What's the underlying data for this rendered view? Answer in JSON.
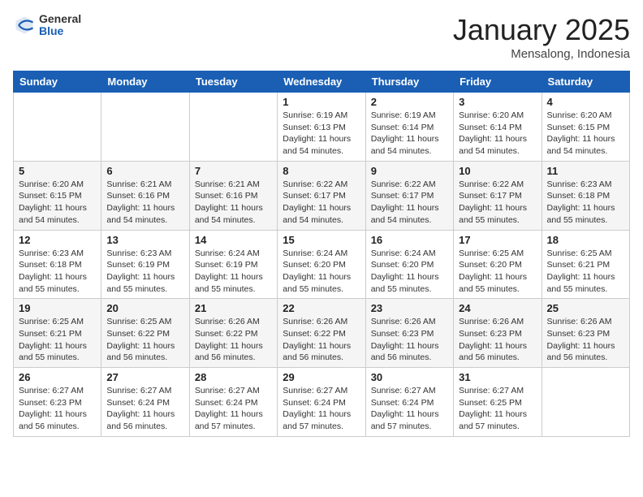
{
  "header": {
    "logo_general": "General",
    "logo_blue": "Blue",
    "month_title": "January 2025",
    "location": "Mensalong, Indonesia"
  },
  "weekdays": [
    "Sunday",
    "Monday",
    "Tuesday",
    "Wednesday",
    "Thursday",
    "Friday",
    "Saturday"
  ],
  "weeks": [
    [
      {
        "day": "",
        "sunrise": "",
        "sunset": "",
        "daylight": ""
      },
      {
        "day": "",
        "sunrise": "",
        "sunset": "",
        "daylight": ""
      },
      {
        "day": "",
        "sunrise": "",
        "sunset": "",
        "daylight": ""
      },
      {
        "day": "1",
        "sunrise": "Sunrise: 6:19 AM",
        "sunset": "Sunset: 6:13 PM",
        "daylight": "Daylight: 11 hours and 54 minutes."
      },
      {
        "day": "2",
        "sunrise": "Sunrise: 6:19 AM",
        "sunset": "Sunset: 6:14 PM",
        "daylight": "Daylight: 11 hours and 54 minutes."
      },
      {
        "day": "3",
        "sunrise": "Sunrise: 6:20 AM",
        "sunset": "Sunset: 6:14 PM",
        "daylight": "Daylight: 11 hours and 54 minutes."
      },
      {
        "day": "4",
        "sunrise": "Sunrise: 6:20 AM",
        "sunset": "Sunset: 6:15 PM",
        "daylight": "Daylight: 11 hours and 54 minutes."
      }
    ],
    [
      {
        "day": "5",
        "sunrise": "Sunrise: 6:20 AM",
        "sunset": "Sunset: 6:15 PM",
        "daylight": "Daylight: 11 hours and 54 minutes."
      },
      {
        "day": "6",
        "sunrise": "Sunrise: 6:21 AM",
        "sunset": "Sunset: 6:16 PM",
        "daylight": "Daylight: 11 hours and 54 minutes."
      },
      {
        "day": "7",
        "sunrise": "Sunrise: 6:21 AM",
        "sunset": "Sunset: 6:16 PM",
        "daylight": "Daylight: 11 hours and 54 minutes."
      },
      {
        "day": "8",
        "sunrise": "Sunrise: 6:22 AM",
        "sunset": "Sunset: 6:17 PM",
        "daylight": "Daylight: 11 hours and 54 minutes."
      },
      {
        "day": "9",
        "sunrise": "Sunrise: 6:22 AM",
        "sunset": "Sunset: 6:17 PM",
        "daylight": "Daylight: 11 hours and 54 minutes."
      },
      {
        "day": "10",
        "sunrise": "Sunrise: 6:22 AM",
        "sunset": "Sunset: 6:17 PM",
        "daylight": "Daylight: 11 hours and 55 minutes."
      },
      {
        "day": "11",
        "sunrise": "Sunrise: 6:23 AM",
        "sunset": "Sunset: 6:18 PM",
        "daylight": "Daylight: 11 hours and 55 minutes."
      }
    ],
    [
      {
        "day": "12",
        "sunrise": "Sunrise: 6:23 AM",
        "sunset": "Sunset: 6:18 PM",
        "daylight": "Daylight: 11 hours and 55 minutes."
      },
      {
        "day": "13",
        "sunrise": "Sunrise: 6:23 AM",
        "sunset": "Sunset: 6:19 PM",
        "daylight": "Daylight: 11 hours and 55 minutes."
      },
      {
        "day": "14",
        "sunrise": "Sunrise: 6:24 AM",
        "sunset": "Sunset: 6:19 PM",
        "daylight": "Daylight: 11 hours and 55 minutes."
      },
      {
        "day": "15",
        "sunrise": "Sunrise: 6:24 AM",
        "sunset": "Sunset: 6:20 PM",
        "daylight": "Daylight: 11 hours and 55 minutes."
      },
      {
        "day": "16",
        "sunrise": "Sunrise: 6:24 AM",
        "sunset": "Sunset: 6:20 PM",
        "daylight": "Daylight: 11 hours and 55 minutes."
      },
      {
        "day": "17",
        "sunrise": "Sunrise: 6:25 AM",
        "sunset": "Sunset: 6:20 PM",
        "daylight": "Daylight: 11 hours and 55 minutes."
      },
      {
        "day": "18",
        "sunrise": "Sunrise: 6:25 AM",
        "sunset": "Sunset: 6:21 PM",
        "daylight": "Daylight: 11 hours and 55 minutes."
      }
    ],
    [
      {
        "day": "19",
        "sunrise": "Sunrise: 6:25 AM",
        "sunset": "Sunset: 6:21 PM",
        "daylight": "Daylight: 11 hours and 55 minutes."
      },
      {
        "day": "20",
        "sunrise": "Sunrise: 6:25 AM",
        "sunset": "Sunset: 6:22 PM",
        "daylight": "Daylight: 11 hours and 56 minutes."
      },
      {
        "day": "21",
        "sunrise": "Sunrise: 6:26 AM",
        "sunset": "Sunset: 6:22 PM",
        "daylight": "Daylight: 11 hours and 56 minutes."
      },
      {
        "day": "22",
        "sunrise": "Sunrise: 6:26 AM",
        "sunset": "Sunset: 6:22 PM",
        "daylight": "Daylight: 11 hours and 56 minutes."
      },
      {
        "day": "23",
        "sunrise": "Sunrise: 6:26 AM",
        "sunset": "Sunset: 6:23 PM",
        "daylight": "Daylight: 11 hours and 56 minutes."
      },
      {
        "day": "24",
        "sunrise": "Sunrise: 6:26 AM",
        "sunset": "Sunset: 6:23 PM",
        "daylight": "Daylight: 11 hours and 56 minutes."
      },
      {
        "day": "25",
        "sunrise": "Sunrise: 6:26 AM",
        "sunset": "Sunset: 6:23 PM",
        "daylight": "Daylight: 11 hours and 56 minutes."
      }
    ],
    [
      {
        "day": "26",
        "sunrise": "Sunrise: 6:27 AM",
        "sunset": "Sunset: 6:23 PM",
        "daylight": "Daylight: 11 hours and 56 minutes."
      },
      {
        "day": "27",
        "sunrise": "Sunrise: 6:27 AM",
        "sunset": "Sunset: 6:24 PM",
        "daylight": "Daylight: 11 hours and 56 minutes."
      },
      {
        "day": "28",
        "sunrise": "Sunrise: 6:27 AM",
        "sunset": "Sunset: 6:24 PM",
        "daylight": "Daylight: 11 hours and 57 minutes."
      },
      {
        "day": "29",
        "sunrise": "Sunrise: 6:27 AM",
        "sunset": "Sunset: 6:24 PM",
        "daylight": "Daylight: 11 hours and 57 minutes."
      },
      {
        "day": "30",
        "sunrise": "Sunrise: 6:27 AM",
        "sunset": "Sunset: 6:24 PM",
        "daylight": "Daylight: 11 hours and 57 minutes."
      },
      {
        "day": "31",
        "sunrise": "Sunrise: 6:27 AM",
        "sunset": "Sunset: 6:25 PM",
        "daylight": "Daylight: 11 hours and 57 minutes."
      },
      {
        "day": "",
        "sunrise": "",
        "sunset": "",
        "daylight": ""
      }
    ]
  ]
}
